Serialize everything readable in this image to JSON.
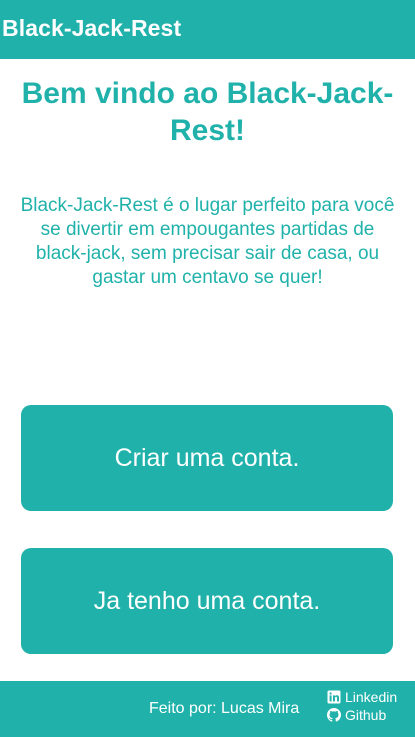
{
  "header": {
    "title": "Black-Jack-Rest"
  },
  "main": {
    "welcome_title": "Bem vindo ao Black-Jack-Rest!",
    "description": "Black-Jack-Rest é o lugar perfeito para você se divertir em empougantes partidas de black-jack, sem precisar sair de casa, ou gastar um centavo se quer!",
    "create_account_label": "Criar uma conta.",
    "have_account_label": "Ja tenho uma conta."
  },
  "footer": {
    "credit": "Feito por: Lucas Mira",
    "links": [
      {
        "label": "Linkedin",
        "icon": "linkedin-icon"
      },
      {
        "label": "Github",
        "icon": "github-icon"
      }
    ]
  },
  "colors": {
    "accent": "#20b2aa",
    "text_on_accent": "#ffffff",
    "background": "#ffffff"
  }
}
